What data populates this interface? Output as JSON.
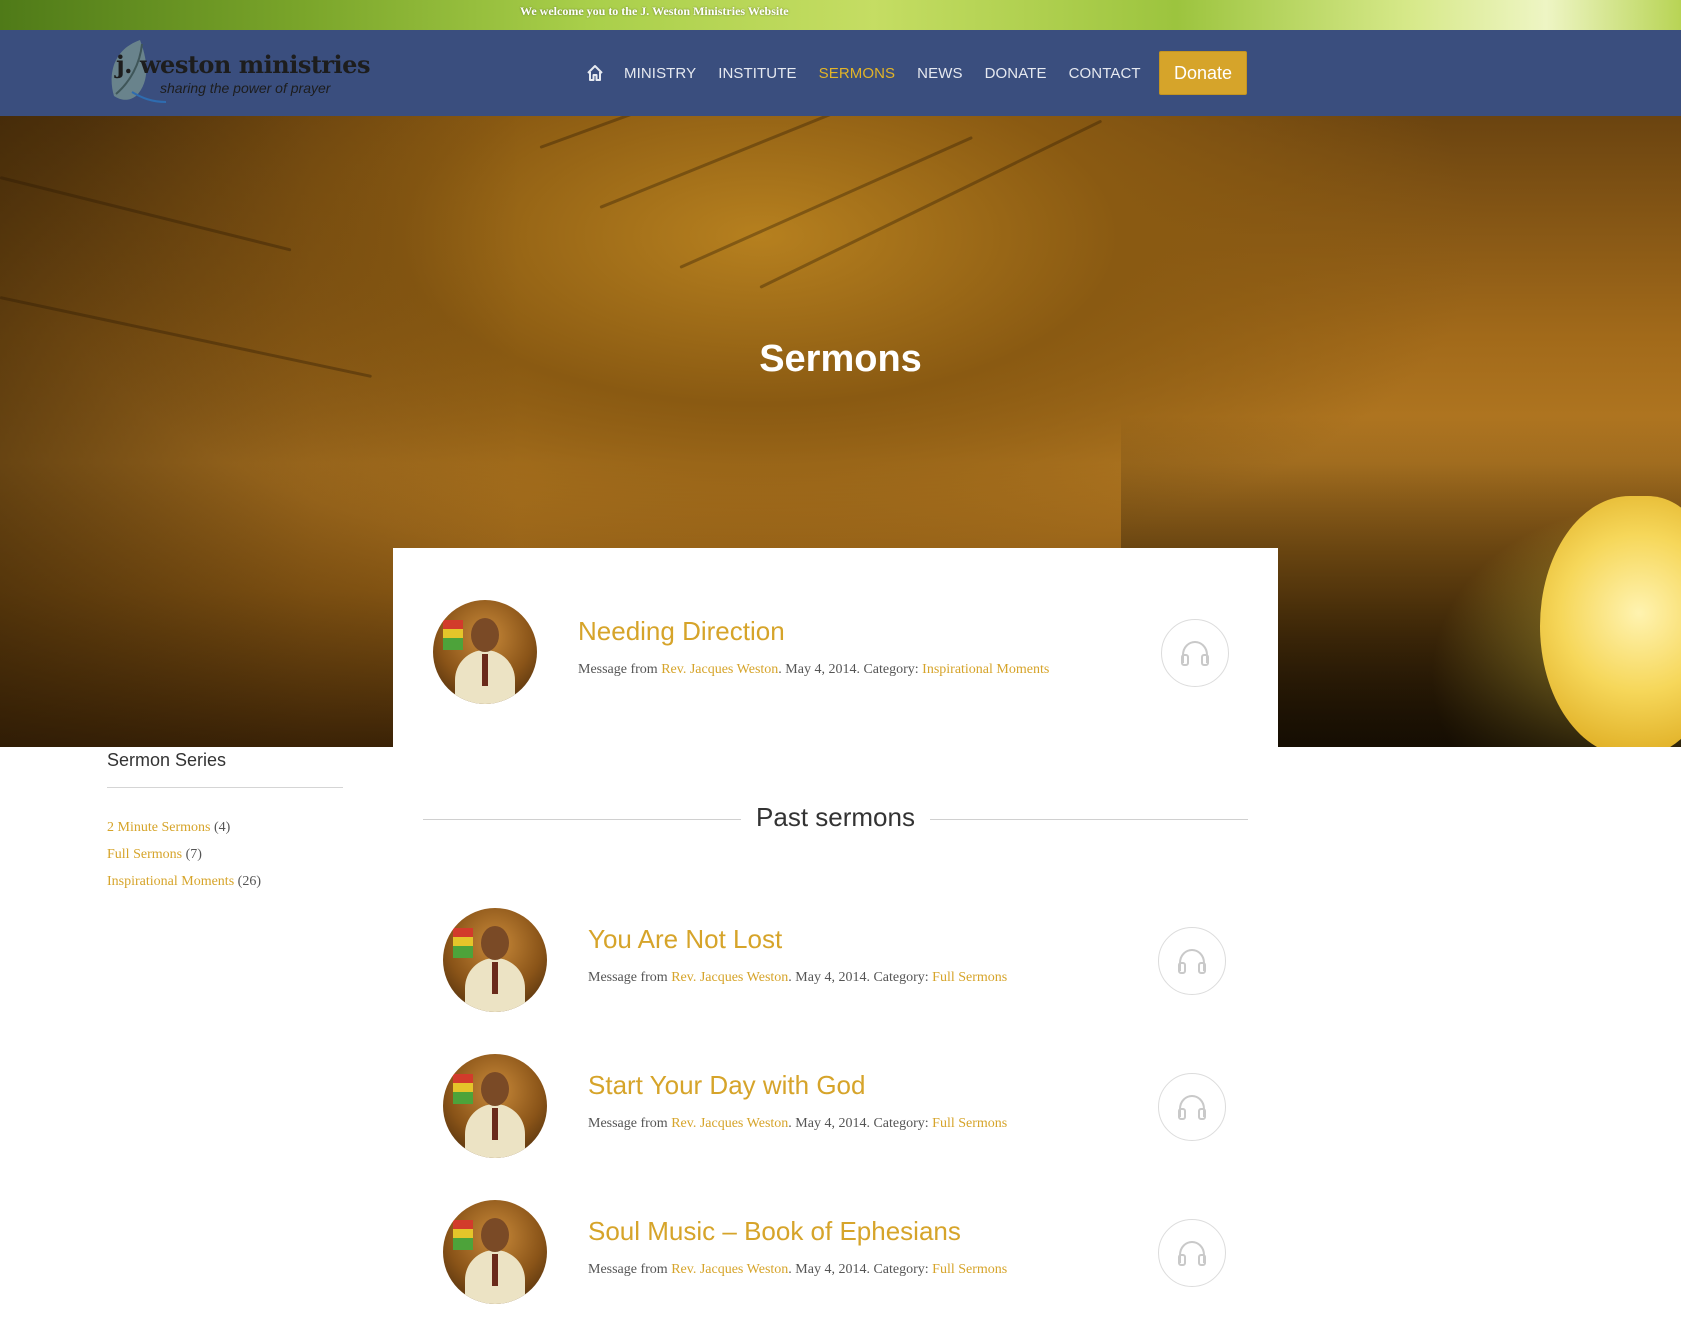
{
  "topbar": {
    "welcome": "We welcome you to the J. Weston Ministries Website"
  },
  "logo": {
    "title": "j. weston ministries",
    "tagline": "sharing the power of prayer"
  },
  "nav": {
    "home_icon": "home-icon",
    "items": [
      {
        "label": "MINISTRY",
        "active": false
      },
      {
        "label": "INSTITUTE",
        "active": false
      },
      {
        "label": "SERMONS",
        "active": true
      },
      {
        "label": "NEWS",
        "active": false
      },
      {
        "label": "DONATE",
        "active": false
      },
      {
        "label": "CONTACT",
        "active": false
      }
    ],
    "donate_button": "Donate"
  },
  "hero": {
    "title": "Sermons"
  },
  "featured": {
    "title": "Needing Direction",
    "meta_prefix": "Message from",
    "author": "Rev. Jacques Weston",
    "date_text": ". May 4, 2014. Category:",
    "category": "Inspirational Moments",
    "icon": "headphones-icon"
  },
  "sidebar": {
    "heading": "Sermon Series",
    "items": [
      {
        "label": "2 Minute Sermons",
        "count": "(4)"
      },
      {
        "label": "Full Sermons",
        "count": "(7)"
      },
      {
        "label": "Inspirational Moments",
        "count": "(26)"
      }
    ]
  },
  "past": {
    "heading": "Past sermons",
    "sermons": [
      {
        "title": "You Are Not Lost",
        "meta_prefix": "Message from",
        "author": "Rev. Jacques Weston",
        "date_text": ". May 4, 2014. Category:",
        "category": "Full Sermons"
      },
      {
        "title": "Start Your Day with God",
        "meta_prefix": "Message from",
        "author": "Rev. Jacques Weston",
        "date_text": ". May 4, 2014. Category:",
        "category": "Full Sermons"
      },
      {
        "title": "Soul Music – Book of Ephesians",
        "meta_prefix": "Message from",
        "author": "Rev. Jacques Weston",
        "date_text": ". May 4, 2014. Category:",
        "category": "Full Sermons"
      }
    ]
  },
  "colors": {
    "accent": "#d6a42a",
    "header_bg": "#3a4e7e",
    "nav_active": "#e2b427"
  }
}
